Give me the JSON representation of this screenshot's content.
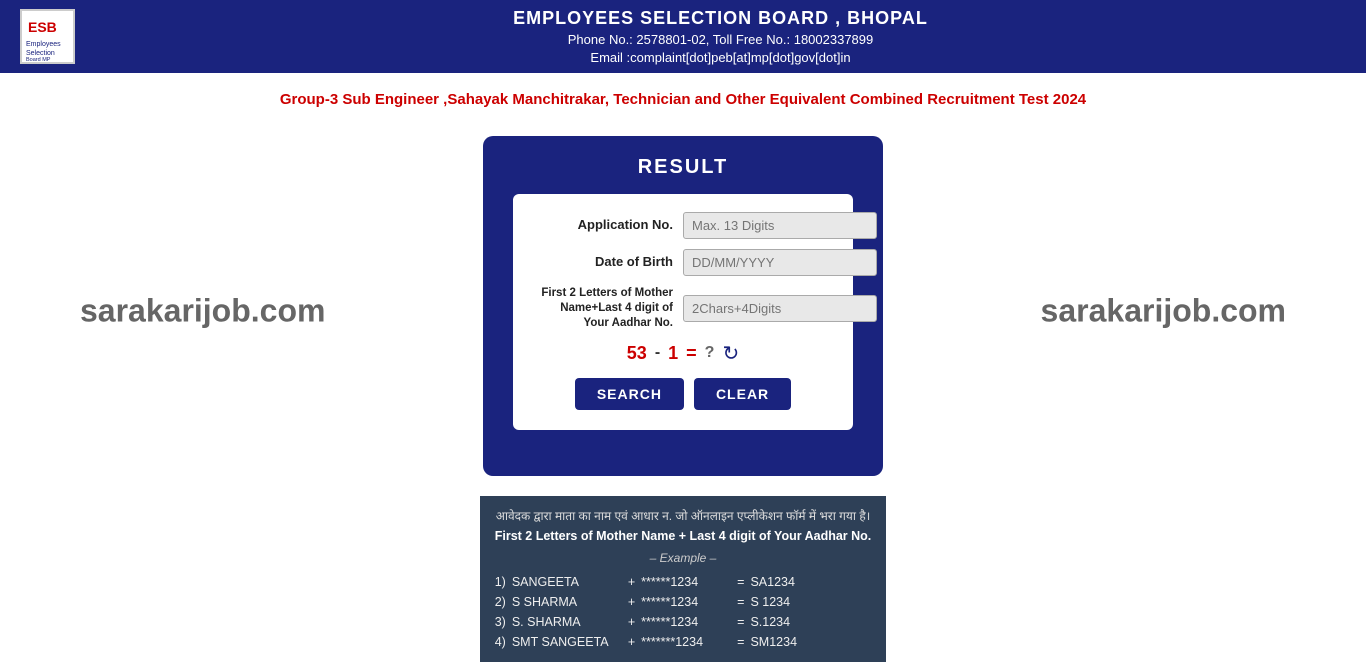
{
  "header": {
    "title": "EMPLOYEES SELECTION BOARD , BHOPAL",
    "phone": "Phone No.: 2578801-02, Toll Free No.: 18002337899",
    "email": "Email :complaint[dot]peb[at]mp[dot]gov[dot]in"
  },
  "subtitle": "Group-3 Sub Engineer ,Sahayak Manchitrakar, Technician and Other Equivalent Combined Recruitment Test 2024",
  "watermark_left": "sarakarijob.com",
  "watermark_right": "sarakarijob.com",
  "form": {
    "title": "RESULT",
    "fields": [
      {
        "label": "Application No.",
        "placeholder": "Max. 13 Digits",
        "id": "app-no"
      },
      {
        "label": "Date of Birth",
        "placeholder": "DD/MM/YYYY",
        "id": "dob"
      },
      {
        "label": "First 2 Letters of Mother Name+Last 4 digit of Your Aadhar No.",
        "placeholder": "2Chars+4Digits",
        "id": "mother"
      }
    ],
    "captcha": {
      "num1": "53",
      "operator": "-",
      "num2": "1",
      "equals": "=",
      "question": "?",
      "refresh_icon": "↻"
    },
    "buttons": {
      "search": "SEARCH",
      "clear": "CLEAR"
    }
  },
  "infobox": {
    "header": "आवेदक द्वारा माता का नाम एवं आधार न. जो ऑनलाइन एप्लीकेशन फॉर्म में भरा गया है।",
    "subheader": "First 2 Letters of Mother Name + Last 4 digit of Your Aadhar No.",
    "example_label": "– Example –",
    "rows": [
      {
        "num": "1)",
        "name": "SANGEETA",
        "plus": "+",
        "aadhar": "******1234",
        "equals": "=",
        "result": "SA1234"
      },
      {
        "num": "2)",
        "name": "S SHARMA",
        "plus": "+",
        "aadhar": "******1234",
        "equals": "=",
        "result": "S 1234"
      },
      {
        "num": "3)",
        "name": "S. SHARMA",
        "plus": "+",
        "aadhar": "******1234",
        "equals": "=",
        "result": "S.1234"
      },
      {
        "num": "4)",
        "name": "SMT SANGEETA",
        "plus": "+",
        "aadhar": "*******1234",
        "equals": "=",
        "result": "SM1234"
      }
    ]
  }
}
